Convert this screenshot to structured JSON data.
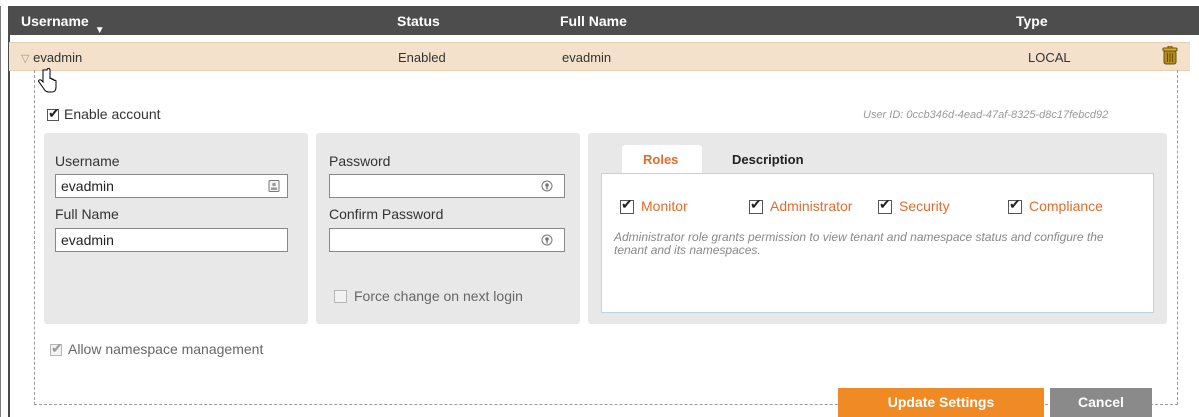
{
  "table": {
    "headers": [
      "Username",
      "Status",
      "Full Name",
      "Type"
    ],
    "sort_caret": "▼",
    "row": {
      "expand_glyph": "▽",
      "username": "evadmin",
      "status": "Enabled",
      "full_name": "evadmin",
      "type": "LOCAL"
    }
  },
  "detail": {
    "enable_account_label": "Enable account",
    "enable_account_checked": true,
    "user_id": "User ID: 0ccb346d-4ead-47af-8325-d8c17febcd92",
    "identity": {
      "username_label": "Username",
      "username_value": "evadmin",
      "full_name_label": "Full Name",
      "full_name_value": "evadmin"
    },
    "password": {
      "password_label": "Password",
      "confirm_label": "Confirm Password",
      "force_change_label": "Force change on next login",
      "force_change_checked": false
    },
    "tabs": [
      "Roles",
      "Description"
    ],
    "active_tab": "Roles",
    "roles": [
      {
        "label": "Monitor",
        "checked": true
      },
      {
        "label": "Administrator",
        "checked": true
      },
      {
        "label": "Security",
        "checked": true
      },
      {
        "label": "Compliance",
        "checked": true
      }
    ],
    "role_description": "Administrator role grants permission to view tenant and namespace status and configure the tenant and its namespaces.",
    "allow_ns_label": "Allow namespace management",
    "allow_ns_checked": true
  },
  "buttons": {
    "update": "Update Settings",
    "cancel": "Cancel"
  },
  "colors": {
    "accent": "#e36b2c",
    "header_bg": "#4d4d4d",
    "row_highlight": "#f4e1cc",
    "panel_bg": "#e8e8e8",
    "update_btn": "#f08a24",
    "cancel_btn": "#8a8a8a"
  },
  "icons": [
    "sort-caret-icon",
    "expand-triangle-icon",
    "trash-can-icon",
    "hand-cursor-icon",
    "id-card-icon",
    "password-key-icon"
  ]
}
